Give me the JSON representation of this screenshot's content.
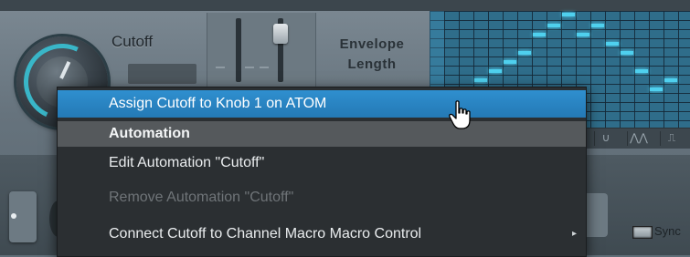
{
  "panel": {
    "cutoff_label": "Cutoff",
    "envelope_label_line1": "Envelope",
    "envelope_label_line2": "Length",
    "sync_label": "Sync",
    "wave_shapes": [
      "∪",
      "⋀⋀",
      "⎍"
    ]
  },
  "context_menu": {
    "items": [
      {
        "label": "Assign Cutoff to Knob 1 on ATOM",
        "state": "highlighted"
      },
      {
        "label": "Automation",
        "state": "header"
      },
      {
        "label": "Edit Automation \"Cutoff\"",
        "state": "enabled"
      },
      {
        "label": "Remove Automation \"Cutoff\"",
        "state": "disabled"
      },
      {
        "label": "Connect Cutoff to Channel Macro Macro Control",
        "state": "submenu"
      }
    ],
    "submenu_arrow": "▸"
  },
  "colors": {
    "highlight": "#2f8fcf",
    "menu_bg": "#2b2f32",
    "accent": "#39b6c8"
  }
}
